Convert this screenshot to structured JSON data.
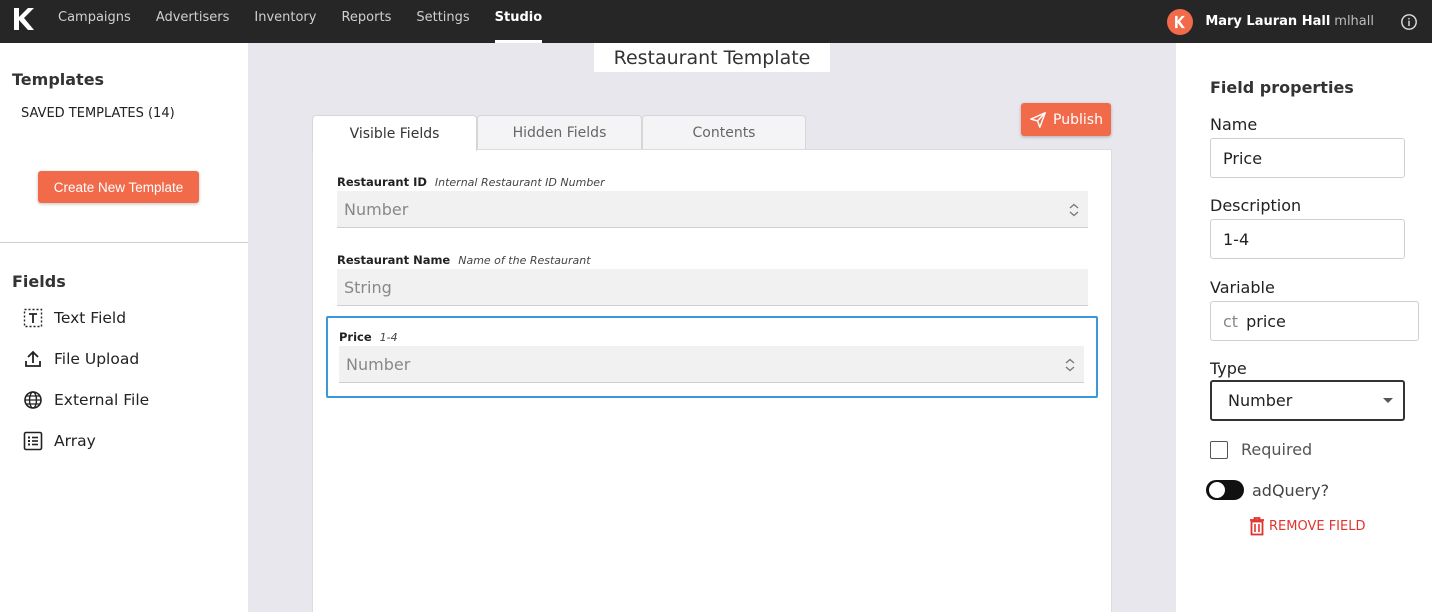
{
  "nav": {
    "items": [
      {
        "label": "Campaigns"
      },
      {
        "label": "Advertisers"
      },
      {
        "label": "Inventory"
      },
      {
        "label": "Reports"
      },
      {
        "label": "Settings"
      },
      {
        "label": "Studio"
      }
    ],
    "active": "Studio",
    "user": {
      "name": "Mary Lauran Hall",
      "handle": "mlhall"
    }
  },
  "sidebar": {
    "templates_title": "Templates",
    "saved_label": "SAVED TEMPLATES (14)",
    "create_button": "Create New Template",
    "fields_title": "Fields",
    "field_types": [
      {
        "label": "Text Field",
        "icon": "text-field-icon"
      },
      {
        "label": "File Upload",
        "icon": "upload-icon"
      },
      {
        "label": "External File",
        "icon": "globe-icon"
      },
      {
        "label": "Array",
        "icon": "list-icon"
      }
    ]
  },
  "editor": {
    "title": "Restaurant Template",
    "publish_label": "Publish",
    "tabs": [
      {
        "label": "Visible Fields",
        "active": true
      },
      {
        "label": "Hidden Fields",
        "active": false
      },
      {
        "label": "Contents",
        "active": false
      }
    ],
    "fields": [
      {
        "name": "Restaurant ID",
        "description": "Internal Restaurant ID Number",
        "placeholder": "Number",
        "spinner": true
      },
      {
        "name": "Restaurant Name",
        "description": "Name of the Restaurant",
        "placeholder": "String",
        "spinner": false
      },
      {
        "name": "Price",
        "description": "1-4",
        "placeholder": "Number",
        "spinner": true,
        "selected": true
      }
    ]
  },
  "properties": {
    "title": "Field properties",
    "name_label": "Name",
    "name_value": "Price",
    "description_label": "Description",
    "description_value": "1-4",
    "variable_label": "Variable",
    "variable_prefix": "ct",
    "variable_value": "price",
    "type_label": "Type",
    "type_value": "Number",
    "required_label": "Required",
    "required_checked": false,
    "adquery_label": "adQuery?",
    "adquery_on": false,
    "remove_label": "REMOVE FIELD"
  },
  "colors": {
    "accent": "#f16a4a",
    "selection": "#3d97db",
    "danger": "#e0342c",
    "topbar": "#262626",
    "canvas": "#e7e7ed"
  }
}
